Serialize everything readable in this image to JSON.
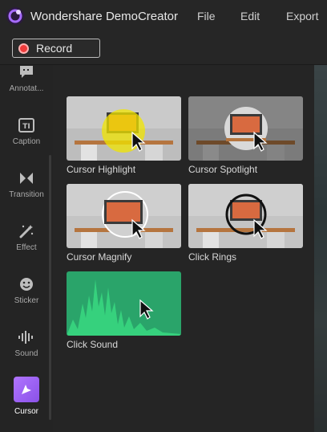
{
  "app": {
    "title": "Wondershare DemoCreator"
  },
  "menu": {
    "file": "File",
    "edit": "Edit",
    "export": "Export"
  },
  "toolbar": {
    "record_label": "Record"
  },
  "sidebar": {
    "items": [
      {
        "label": "Annotat...",
        "icon": "annotation-icon"
      },
      {
        "label": "Caption",
        "icon": "caption-icon"
      },
      {
        "label": "Transition",
        "icon": "transition-icon"
      },
      {
        "label": "Effect",
        "icon": "effect-wand-icon"
      },
      {
        "label": "Sticker",
        "icon": "sticker-icon"
      },
      {
        "label": "Sound",
        "icon": "sound-wave-icon"
      },
      {
        "label": "Cursor",
        "icon": "cursor-icon",
        "active": true
      }
    ]
  },
  "effects": [
    {
      "label": "Cursor Highlight"
    },
    {
      "label": "Cursor Spotlight"
    },
    {
      "label": "Cursor Magnify"
    },
    {
      "label": "Click Rings"
    },
    {
      "label": "Click Sound"
    }
  ],
  "colors": {
    "accent": "#9b63f5",
    "record": "#ef3b3b",
    "highlight": "#f2e600",
    "sound_bg": "#2aa46a"
  }
}
